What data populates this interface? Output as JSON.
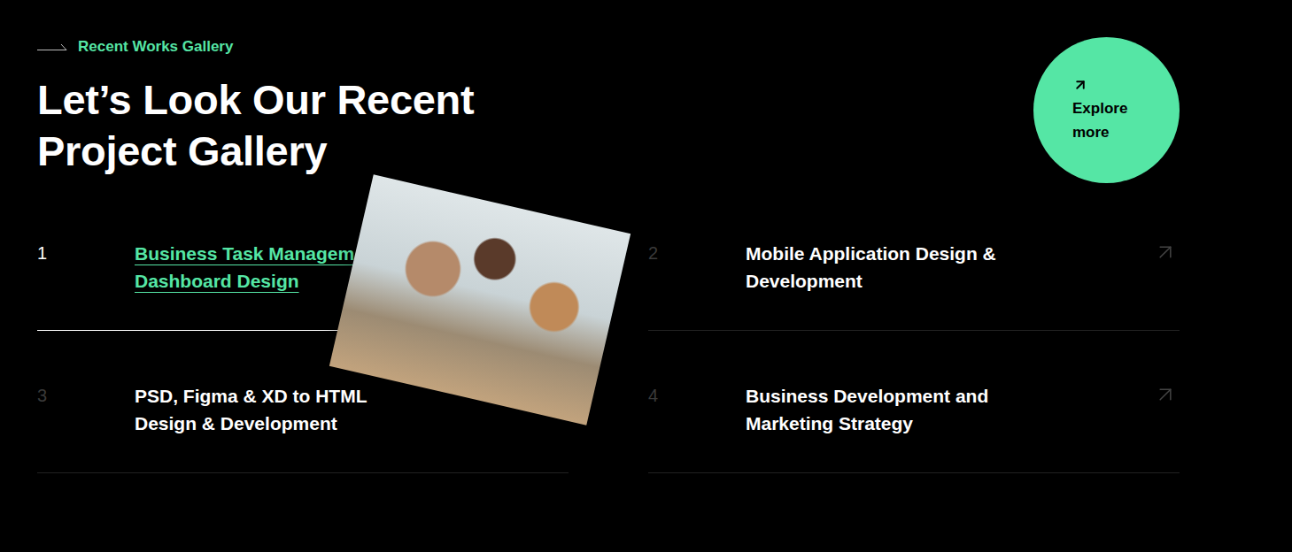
{
  "eyebrow": "Recent Works Gallery",
  "heading": [
    "Let’s Look Our Recent",
    "Project Gallery"
  ],
  "explore_button": {
    "label": "Explore more"
  },
  "projects": [
    {
      "number": "1",
      "lines": [
        "Business Task Managem",
        "Dashboard Design"
      ],
      "selected": true
    },
    {
      "number": "2",
      "lines": [
        "Mobile Application Design &",
        "Development"
      ],
      "selected": false
    },
    {
      "number": "3",
      "lines": [
        "PSD, Figma & XD to HTML",
        "Design & Development"
      ],
      "selected": false
    },
    {
      "number": "4",
      "lines": [
        "Business Development and",
        "Marketing Strategy"
      ],
      "selected": false
    }
  ]
}
